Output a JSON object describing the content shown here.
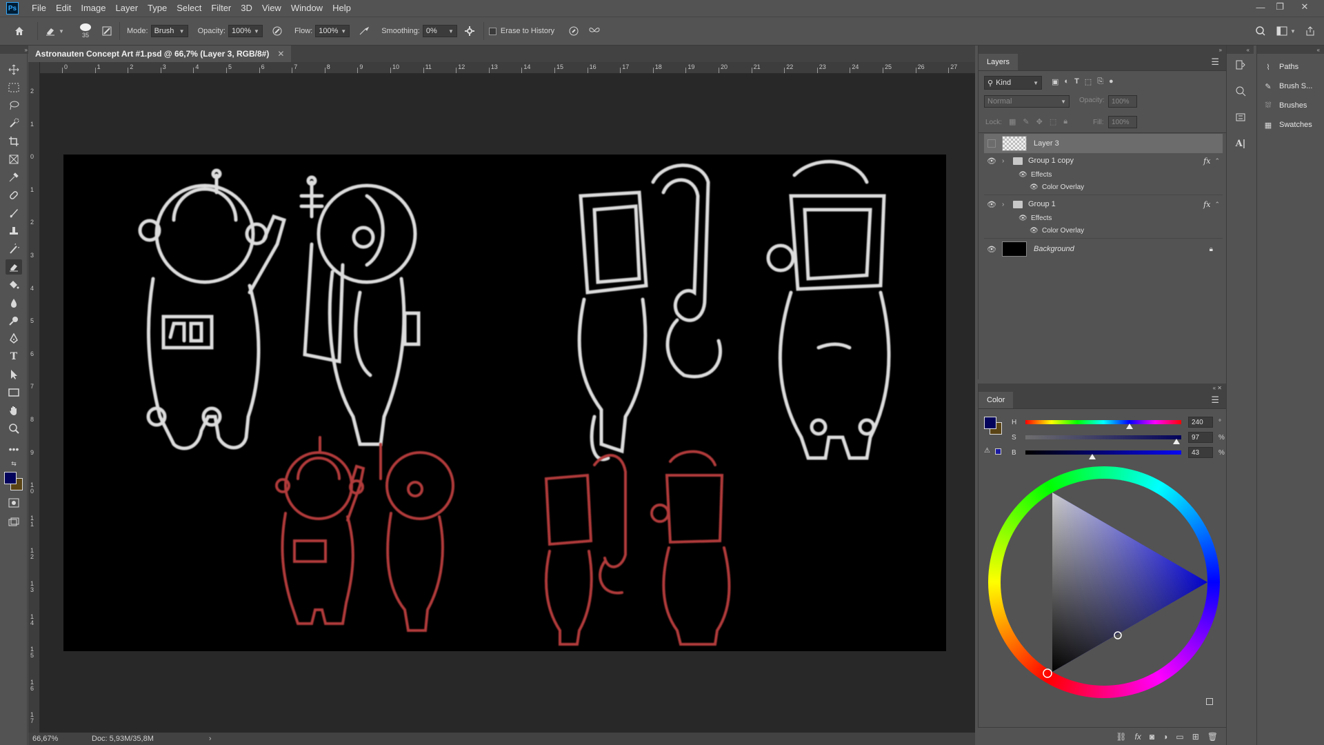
{
  "menu": [
    "File",
    "Edit",
    "Image",
    "Layer",
    "Type",
    "Select",
    "Filter",
    "3D",
    "View",
    "Window",
    "Help"
  ],
  "options": {
    "brush_size": "35",
    "mode_label": "Mode:",
    "mode_value": "Brush",
    "opacity_label": "Opacity:",
    "opacity_value": "100%",
    "flow_label": "Flow:",
    "flow_value": "100%",
    "smoothing_label": "Smoothing:",
    "smoothing_value": "0%",
    "erase_history_label": "Erase to History"
  },
  "document": {
    "tab_title": "Astronauten Concept Art #1.psd @ 66,7% (Layer 3, RGB/8#)",
    "ruler_top": [
      "0",
      "1",
      "2",
      "3",
      "4",
      "5",
      "6",
      "7",
      "8",
      "9",
      "10",
      "11",
      "12",
      "13",
      "14",
      "15",
      "16",
      "17",
      "18",
      "19",
      "20",
      "21",
      "22",
      "23",
      "24",
      "25",
      "26",
      "27"
    ],
    "ruler_left": [
      "2",
      "1",
      "0",
      "1",
      "2",
      "3",
      "4",
      "5",
      "6",
      "7",
      "8",
      "9",
      "1\n0",
      "1\n1",
      "1\n2",
      "1\n3",
      "1\n4",
      "1\n5",
      "1\n6",
      "1\n7"
    ]
  },
  "status": {
    "zoom": "66,67%",
    "doc": "Doc: 5,93M/35,8M"
  },
  "layers_panel": {
    "tab": "Layers",
    "filter_kind": "Kind",
    "blend_mode": "Normal",
    "opacity_label": "Opacity:",
    "opacity_value": "100%",
    "lock_label": "Lock:",
    "fill_label": "Fill:",
    "fill_value": "100%",
    "layers": [
      {
        "name": "Layer 3"
      },
      {
        "name": "Group 1 copy",
        "fx": "fx",
        "effects": "Effects",
        "effect": "Color Overlay"
      },
      {
        "name": "Group 1",
        "fx": "fx",
        "effects": "Effects",
        "effect": "Color Overlay"
      },
      {
        "name": "Background"
      }
    ]
  },
  "color_panel": {
    "tab": "Color",
    "h_label": "H",
    "h_value": "240",
    "h_unit": "°",
    "s_label": "S",
    "s_value": "97",
    "s_unit": "%",
    "b_label": "B",
    "b_value": "43",
    "b_unit": "%",
    "foreground": "#03035c",
    "background": "#5a4314",
    "hue": 240,
    "saturation": 97,
    "brightness": 43
  },
  "shortcuts": [
    "Paths",
    "Brush S...",
    "Brushes",
    "Swatches"
  ]
}
